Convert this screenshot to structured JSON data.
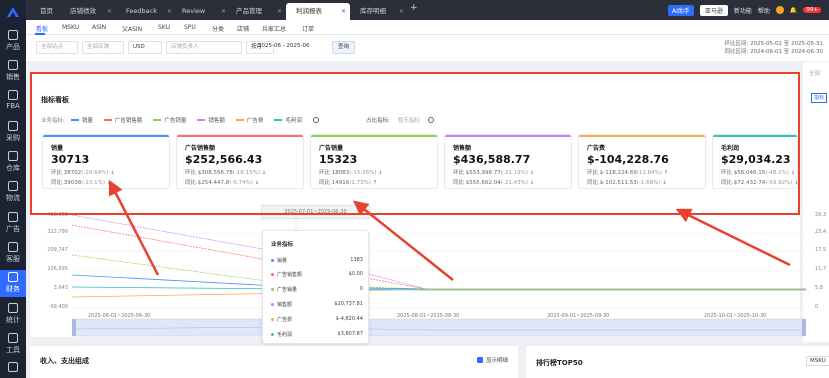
{
  "sidebar": {
    "items": [
      {
        "label": "产品"
      },
      {
        "label": "销售"
      },
      {
        "label": "FBA"
      },
      {
        "label": "采购"
      },
      {
        "label": "仓库"
      },
      {
        "label": "物流"
      },
      {
        "label": "广告"
      },
      {
        "label": "客服"
      },
      {
        "label": "财务"
      },
      {
        "label": "统计"
      },
      {
        "label": "工具"
      }
    ],
    "active_index": 8
  },
  "tabs": [
    {
      "label": "首页"
    },
    {
      "label": "店铺绩效"
    },
    {
      "label": "Feedback"
    },
    {
      "label": "Review"
    },
    {
      "label": "产品管理"
    },
    {
      "label": "利润报表"
    },
    {
      "label": "库存明细"
    }
  ],
  "topbar": {
    "ai_label": "AI助手",
    "store_label": "亚马逊",
    "new_feature": "新功能",
    "help": "帮助",
    "badge": "99+"
  },
  "subnav": {
    "items": [
      "看板",
      "MSKU",
      "ASIN",
      "父ASIN",
      "SKU",
      "SPU",
      "分类",
      "店铺",
      "兵家汇总",
      "订单"
    ],
    "active_index": 0
  },
  "filters": {
    "site": "全部站点",
    "store": "全部店铺",
    "currency": "USD",
    "manager": "店铺负责人",
    "period": "按月",
    "date_range": "2025-06 - 2025-06",
    "query_btn": "查询",
    "compare1": "环比区间: 2025-05-02 至 2025-05-31",
    "compare2": "同比区间: 2024-06-01 至 2024-06-30"
  },
  "right_strip": {
    "select": "全部",
    "button": "指标"
  },
  "panel": {
    "title": "指标看板",
    "legend_label": "业务指标:",
    "legend": [
      {
        "name": "销量",
        "color": "#4a90ff"
      },
      {
        "name": "广告销售额",
        "color": "#ff6b6b"
      },
      {
        "name": "广告销量",
        "color": "#8bd44a"
      },
      {
        "name": "销售额",
        "color": "#c77dff"
      },
      {
        "name": "广告费",
        "color": "#ffa94d"
      },
      {
        "name": "毛利润",
        "color": "#2ec4b6"
      }
    ],
    "ratio_label": "占比指标:",
    "ratio_value": "暂无指标"
  },
  "cards": [
    {
      "title": "销量",
      "value": "30713",
      "mom": "环比 38702",
      "mom_pct": "(-20.64%)",
      "mom_dir": "↓",
      "yoy": "同比 39038",
      "yoy_pct": "(-23.1%)",
      "yoy_dir": "↓",
      "color": "#4a90ff"
    },
    {
      "title": "广告销售额",
      "value": "$252,566.43",
      "mom": "环比 $308,556.78",
      "mom_pct": "(-18.15%)",
      "mom_dir": "↓",
      "yoy": "同比 $254,447.8",
      "yoy_pct": "(-0.74%)",
      "yoy_dir": "↓",
      "color": "#ff6b6b"
    },
    {
      "title": "广告销量",
      "value": "15323",
      "mom": "环比 18083",
      "mom_pct": "(-15.26%)",
      "mom_dir": "↓",
      "yoy": "同比 14916",
      "yoy_pct": "(2.73%)",
      "yoy_dir": "↑",
      "color": "#8bd44a"
    },
    {
      "title": "销售额",
      "value": "$436,588.77",
      "mom": "环比 $553,998.77",
      "mom_pct": "(-21.19%)",
      "mom_dir": "↓",
      "yoy": "同比 $555,662.04",
      "yoy_pct": "(-21.43%)",
      "yoy_dir": "↓",
      "color": "#c77dff"
    },
    {
      "title": "广告费",
      "value": "$-104,228.76",
      "mom": "环比 $-118,224.69",
      "mom_pct": "(11.84%)",
      "mom_dir": "↑",
      "yoy": "同比 $-102,511.53",
      "yoy_pct": "(-1.68%)",
      "yoy_dir": "↓",
      "color": "#ffa94d"
    },
    {
      "title": "毛利润",
      "value": "$29,034.23",
      "mom": "环比 $56,046.15",
      "mom_pct": "(-48.2%)",
      "mom_dir": "↓",
      "yoy": "同比 $72,432.74",
      "yoy_pct": "(-59.92%)",
      "yoy_dir": "↓",
      "color": "#2ec4b6"
    }
  ],
  "chart": {
    "y_ticks_left": [
      "416,953",
      "312,799",
      "209,747",
      "106,695",
      "3,643",
      "-99,409"
    ],
    "y_ticks_right": [
      "29,3",
      "23,4",
      "17,5",
      "11,7",
      "5,8",
      "0"
    ],
    "x_ticks": [
      "2025-06-01~2025-06-30",
      "2025-08-01~2025-08-30",
      "2025-09-01~2025-09-30",
      "2025-10-01~2025-10-30"
    ],
    "tooltip_header": "2025-07-01~2025-06-30",
    "tooltip_title": "业务指标",
    "tooltip_rows": [
      {
        "name": "销量",
        "value": "1383",
        "color": "#4a90ff"
      },
      {
        "name": "广告销售额",
        "value": "$0.00",
        "color": "#ff6b6b"
      },
      {
        "name": "广告销量",
        "value": "0",
        "color": "#8bd44a"
      },
      {
        "name": "销售额",
        "value": "$20,737.81",
        "color": "#c77dff"
      },
      {
        "name": "广告费",
        "value": "$-4,820.44",
        "color": "#ffa94d"
      },
      {
        "name": "毛利润",
        "value": "$3,807.87",
        "color": "#2ec4b6"
      }
    ]
  },
  "bottom": {
    "left_title": "收入、支出组成",
    "checkbox_label": "显示明细",
    "right_title": "排行榜TOP50",
    "right_tag": "MSKU"
  }
}
